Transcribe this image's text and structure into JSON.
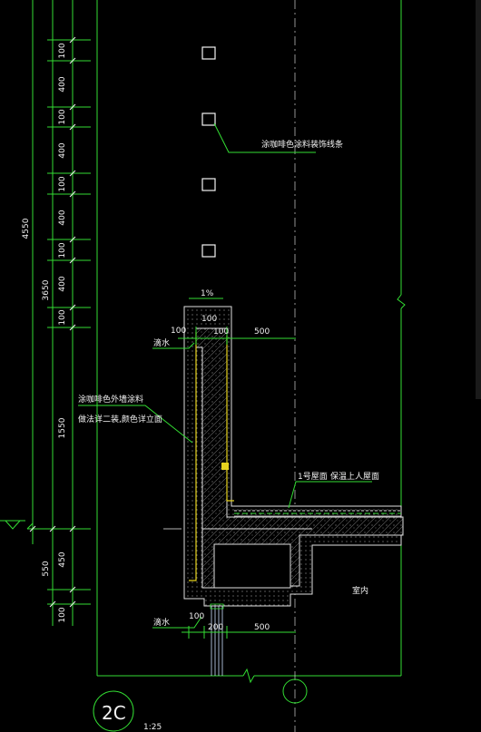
{
  "drawing": {
    "left_dims": [
      "100",
      "400",
      "100",
      "400",
      "100",
      "400",
      "100",
      "400",
      "100",
      "1550",
      "450",
      "100"
    ],
    "total_dims": {
      "overall": "4550",
      "upper": "3650",
      "lower": "550"
    },
    "slope_label": "1%",
    "parapet_dims": {
      "top_width": "100",
      "left_offset": "100",
      "inner": "100",
      "right_500": "500"
    },
    "bottom_dims": {
      "left": "100",
      "mid": "200",
      "right": "500"
    },
    "drip_top": "滴水",
    "drip_bottom": "滴水",
    "note_decor_strip": "涂咖啡色涂料装饰线条",
    "note_wall_paint": [
      "涂咖啡色外墙涂料",
      "做法详二装,颜色详立面"
    ],
    "roof_code": "1号屋面",
    "roof_desc": "保温上人屋面",
    "room_label": "室内",
    "detail_id": "2C",
    "detail_scale": "1:25"
  }
}
